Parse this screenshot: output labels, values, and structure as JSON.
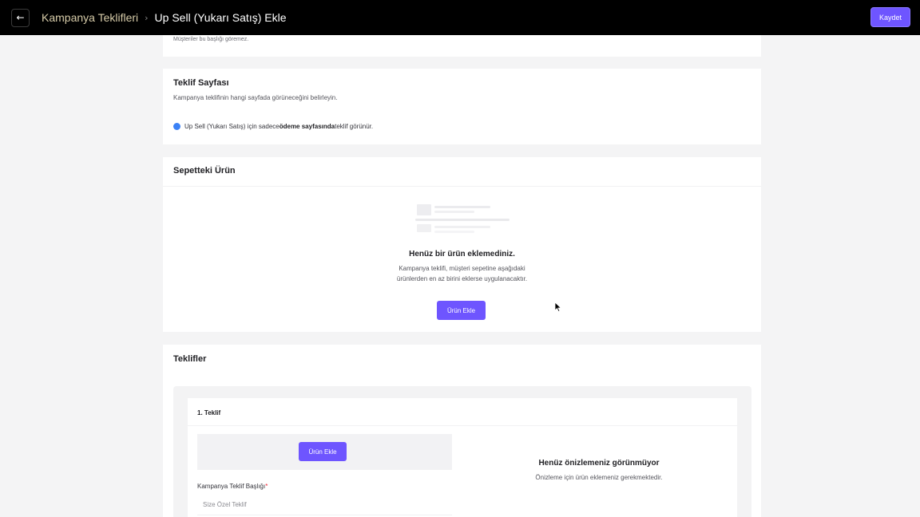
{
  "header": {
    "back_icon": "arrow-left-icon",
    "breadcrumb_parent": "Kampanya Teklifleri",
    "breadcrumb_separator": "›",
    "breadcrumb_current": "Up Sell (Yukarı Satış) Ekle",
    "save_label": "Kaydet"
  },
  "top_card": {
    "subtext": "Müşteriler bu başlığı göremez."
  },
  "offer_page": {
    "title": "Teklif Sayfası",
    "description": "Kampanya teklifinin hangi sayfada görüneceğini belirleyin.",
    "info_prefix": "Up Sell (Yukarı Satış) için sadece ",
    "info_bold": "ödeme sayfasında",
    "info_suffix": " teklif görünür."
  },
  "cart_product": {
    "title": "Sepetteki Ürün",
    "empty_title": "Henüz bir ürün eklemediniz.",
    "empty_desc_line1": "Kampanya teklifi, müşteri sepetine aşağıdaki",
    "empty_desc_line2": "ürünlerden en az birini eklerse uygulanacaktır.",
    "add_button": "Ürün Ekle"
  },
  "offers": {
    "title": "Teklifler",
    "items": [
      {
        "label": "1. Teklif",
        "add_button": "Ürün Ekle",
        "field_label": "Kampanya Teklif Başlığı",
        "field_required": "*",
        "field_placeholder": "Size Özel Teklif",
        "preview_title": "Henüz önizlemeniz görünmüyor",
        "preview_desc": "Önizleme için ürün eklemeniz gerekmektedir."
      }
    ]
  },
  "colors": {
    "topbar": "#000000",
    "accent": "#6e55ff",
    "breadcrumb_parent": "#d6cba8",
    "info": "#3b82f6",
    "page_bg": "#f4f4f5"
  }
}
